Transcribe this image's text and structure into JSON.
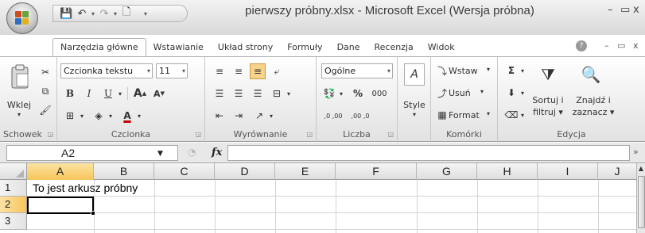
{
  "title": {
    "text": "pierwszy próbny.xlsx - Microsoft Excel (Wersja próbna)",
    "minimize": "–",
    "restore": "▭",
    "close": "x"
  },
  "qat": {
    "save": "💾",
    "undo": "↶",
    "redo": "↷",
    "new": "🗋",
    "dropdown": "▾",
    "customize": "▾"
  },
  "tabs": [
    "Narzędzia główne",
    "Wstawianie",
    "Układ strony",
    "Formuły",
    "Dane",
    "Recenzja",
    "Widok"
  ],
  "ribbon_controls": {
    "help": "?",
    "minimize": "–",
    "restore": "▭",
    "close": "x"
  },
  "clipboard": {
    "paste": "Wklej",
    "paste_arrow": "▾",
    "group": "Schowek"
  },
  "font": {
    "name": "Czcionka tekstu",
    "size": "11",
    "bold": "B",
    "italic": "I",
    "underline": "U",
    "grow": "A",
    "shrink": "A",
    "color": "A",
    "group": "Czcionka"
  },
  "alignment": {
    "group": "Wyrównanie"
  },
  "number": {
    "format": "Ogólne",
    "percent": "%",
    "thousands": "000",
    "inc_decimal": ",0 ,00",
    "dec_decimal": ",00 ,0",
    "group": "Liczba"
  },
  "styles": {
    "label": "Style",
    "arrow": "▾"
  },
  "cells": {
    "insert": "Wstaw",
    "delete": "Usuń",
    "format": "Format",
    "arrow": "▾",
    "group": "Komórki"
  },
  "editing": {
    "sigma": "Σ",
    "sort_line1": "Sortuj i",
    "sort_line2": "filtruj ▾",
    "find_line1": "Znajdź i",
    "find_line2": "zaznacz ▾",
    "group": "Edycja"
  },
  "formula_bar": {
    "name_box": "A2",
    "fx": "fx",
    "value": ""
  },
  "columns": [
    "A",
    "B",
    "C",
    "D",
    "E",
    "F",
    "G",
    "H",
    "I",
    "J"
  ],
  "rows": [
    "1",
    "2",
    "3"
  ],
  "cell_values": {
    "A1": "To jest arkusz próbny"
  },
  "selection": {
    "active_cell": "A2",
    "active_column": "A",
    "active_row": "2"
  }
}
